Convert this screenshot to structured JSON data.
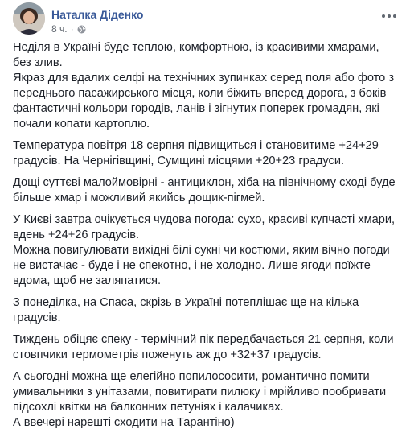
{
  "post": {
    "author": "Наталка Діденко",
    "time": "8 ч.",
    "separator": "·",
    "icons": [
      "avatar",
      "globe-icon",
      "more-options-icon"
    ],
    "paragraphs": [
      "Неділя в Україні буде теплою, комфортною, із красивими хмарами, без злив.\nЯкраз для вдалих селфі на технічних зупинках серед поля або фото з переднього пасажирського місця, коли біжить вперед дорога, з боків фантастичні кольори городів, ланів і зігнутих поперек громадян, які почали копати картоплю.",
      "Температура повітря 18 серпня підвищиться і становитиме +24+29 градусів. На Чернігівщині, Сумщині місцями +20+23 градуси.",
      "Дощі суттєві малоймовірні - антициклон, хіба на північному сході буде більше хмар і можливий якийсь дощик-пігмей.",
      "У Києві завтра очікується чудова погода: сухо, красиві купчасті хмари, вдень +24+26 градусів.\nМожна повигулювати вихідні білі сукні чи костюми, яким вічно погоди не вистачає - буде і не спекотно, і не холодно. Лише ягоди поїжте вдома, щоб не заляпатися.",
      "З понеділка, на Спаса, скрізь в Україні потеплішає ще на кілька градусів.",
      "Тиждень обіцяє спеку - термічний пік передбачається 21 серпня, коли стовпчики термометрів поженуть аж до +32+37 градусів.",
      "А сьогодні можна ще елегійно попилососити, романтично помити умивальники з унітазами, повитирати пилюку і мрійливо пообривати підсохлі квітки на балконних петуніях і калачиках.\nА ввечері нарешті сходити на Тарантіно)"
    ]
  }
}
